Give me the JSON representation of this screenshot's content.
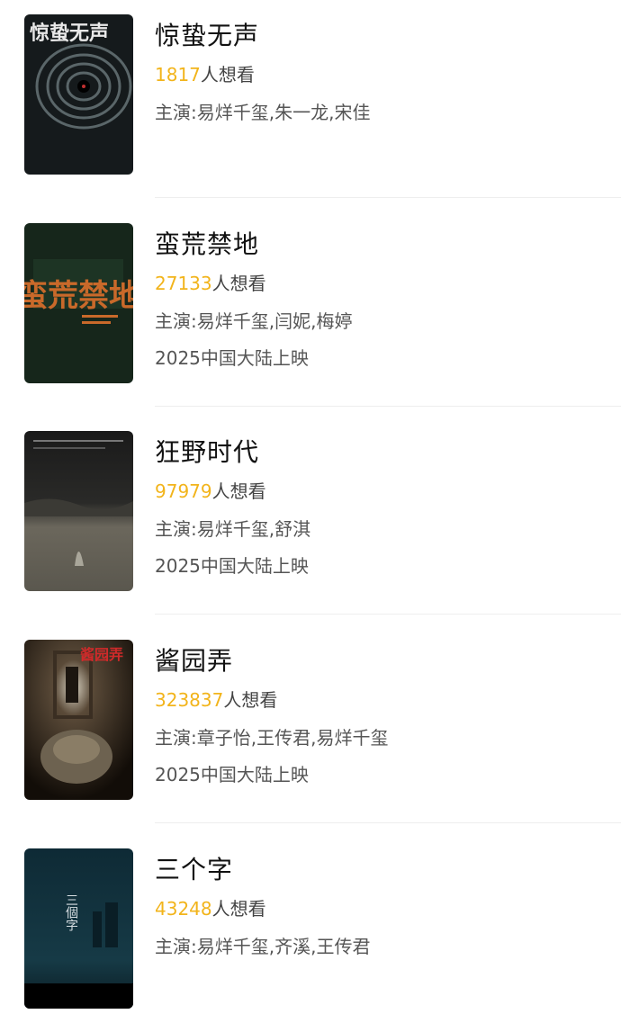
{
  "movies": [
    {
      "title": "惊蛰无声",
      "want_count": "1817",
      "want_suffix": "人想看",
      "cast": "主演:易烊千玺,朱一龙,宋佳",
      "release": "",
      "poster_text": "惊蛰无声"
    },
    {
      "title": "蛮荒禁地",
      "want_count": "27133",
      "want_suffix": "人想看",
      "cast": "主演:易烊千玺,闫妮,梅婷",
      "release": "2025中国大陆上映",
      "poster_text": "蛮荒禁地"
    },
    {
      "title": "狂野时代",
      "want_count": "97979",
      "want_suffix": "人想看",
      "cast": "主演:易烊千玺,舒淇",
      "release": "2025中国大陆上映",
      "poster_text": ""
    },
    {
      "title": "酱园弄",
      "want_count": "323837",
      "want_suffix": "人想看",
      "cast": "主演:章子怡,王传君,易烊千玺",
      "release": "2025中国大陆上映",
      "poster_text": "酱园弄"
    },
    {
      "title": "三个字",
      "want_count": "43248",
      "want_suffix": "人想看",
      "cast": "主演:易烊千玺,齐溪,王传君",
      "release": "",
      "poster_text": "三個字"
    }
  ],
  "colors": {
    "want_count": "#f2b41b",
    "title": "#111111",
    "meta": "#555555",
    "divider": "#eeeeee"
  }
}
